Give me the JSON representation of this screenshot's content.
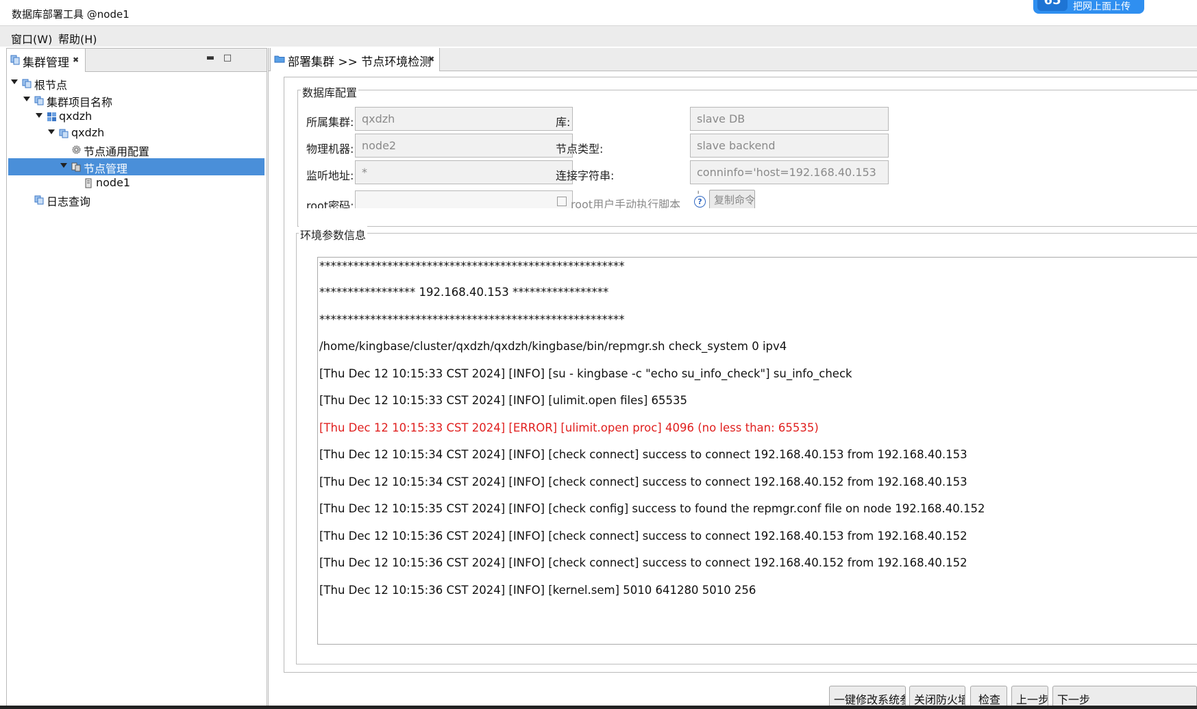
{
  "window": {
    "title": "数据库部署工具 @node1",
    "badge_icon": "65",
    "badge_text": "把网上面上传"
  },
  "menubar": {
    "items": [
      "窗口(W)",
      "帮助(H)"
    ]
  },
  "left_view": {
    "tab_label": "集群管理",
    "tree": [
      {
        "label": "根节点",
        "icon": "cluster-icon",
        "expanded": true
      },
      {
        "label": "集群项目名称",
        "icon": "cluster-icon",
        "expanded": true
      },
      {
        "label": "qxdzh",
        "icon": "database-group-icon",
        "expanded": true
      },
      {
        "label": "qxdzh",
        "icon": "cluster-icon",
        "expanded": true
      },
      {
        "label": "节点通用配置",
        "icon": "gear-icon"
      },
      {
        "label": "节点管理",
        "icon": "node-manage-icon",
        "expanded": true,
        "selected": true
      },
      {
        "label": "node1",
        "icon": "server-icon"
      },
      {
        "label": "日志查询",
        "icon": "cluster-icon"
      }
    ]
  },
  "editor": {
    "tab_label": "部署集群 >> 节点环境检测",
    "db_group": {
      "title": "数据库配置",
      "cluster_label": "所属集群:",
      "cluster_value": "qxdzh",
      "lib_label": "库:",
      "lib_value": "slave DB",
      "machine_label": "物理机器:",
      "machine_value": "node2",
      "node_type_label": "节点类型:",
      "node_type_value": "slave backend",
      "listen_label": "监听地址:",
      "listen_value": "*",
      "conn_label": "连接字符串:",
      "conn_value": "conninfo='host=192.168.40.153 '",
      "root_pwd_label": "root密码:",
      "root_manual_label": "root用户手动执行脚本",
      "copy_btn": "复制命令"
    },
    "env_group": {
      "title": "环境参数信息",
      "log": [
        {
          "text": "******************************************************",
          "error": false
        },
        {
          "text": "***************** 192.168.40.153 *****************",
          "error": false
        },
        {
          "text": "******************************************************",
          "error": false
        },
        {
          "text": "/home/kingbase/cluster/qxdzh/qxdzh/kingbase/bin/repmgr.sh check_system 0 ipv4",
          "error": false
        },
        {
          "text": "[Thu Dec 12 10:15:33 CST 2024] [INFO] [su - kingbase -c \"echo su_info_check\"] su_info_check",
          "error": false
        },
        {
          "text": "[Thu Dec 12 10:15:33 CST 2024] [INFO] [ulimit.open files] 65535",
          "error": false
        },
        {
          "text": "[Thu Dec 12 10:15:33 CST 2024] [ERROR] [ulimit.open proc] 4096 (no less than: 65535)",
          "error": true
        },
        {
          "text": "[Thu Dec 12 10:15:34 CST 2024] [INFO] [check connect] success to connect 192.168.40.153 from 192.168.40.153",
          "error": false
        },
        {
          "text": "[Thu Dec 12 10:15:34 CST 2024] [INFO] [check connect] success to connect 192.168.40.152 from 192.168.40.153",
          "error": false
        },
        {
          "text": "[Thu Dec 12 10:15:35 CST 2024] [INFO] [check config] success to found the repmgr.conf file on node 192.168.40.152",
          "error": false
        },
        {
          "text": "[Thu Dec 12 10:15:36 CST 2024] [INFO] [check connect] success to connect 192.168.40.153 from 192.168.40.152",
          "error": false
        },
        {
          "text": "[Thu Dec 12 10:15:36 CST 2024] [INFO] [check connect] success to connect 192.168.40.152 from 192.168.40.152",
          "error": false
        },
        {
          "text": "[Thu Dec 12 10:15:36 CST 2024] [INFO] [kernel.sem] 5010 641280 5010 256",
          "error": false
        }
      ]
    },
    "buttons": {
      "modify_system": "一键修改系统参数",
      "close_firewall": "关闭防火墙",
      "check": "检查",
      "prev": "上一步",
      "next": "下一步"
    }
  },
  "colors": {
    "selection": "#4a8fd9",
    "error_text": "#e0201f",
    "badge": "#2f8ff0"
  }
}
